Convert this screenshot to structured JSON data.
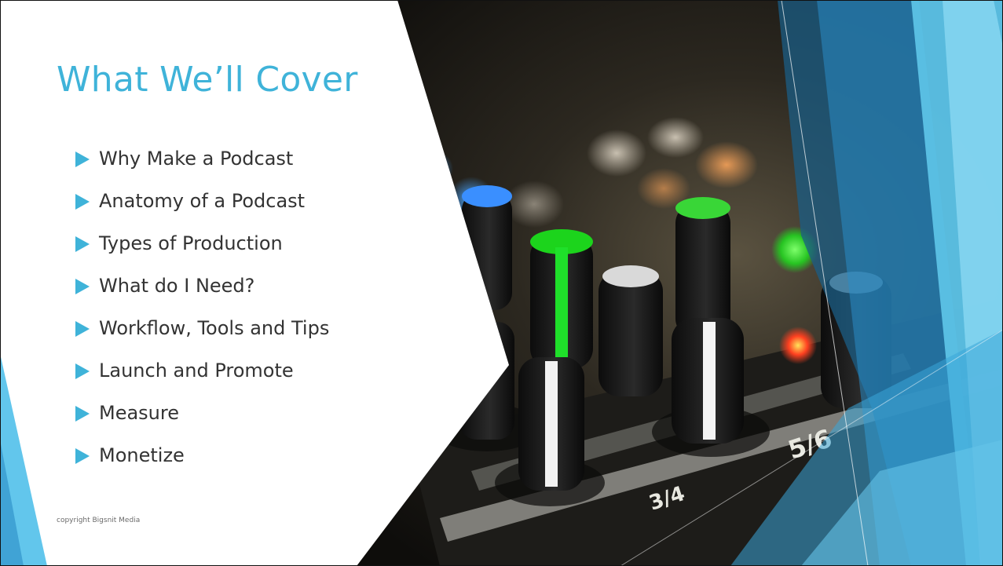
{
  "slide": {
    "title": "What We’ll Cover",
    "bullets": [
      "Why Make a Podcast",
      "Anatomy of a Podcast",
      "Types of Production",
      "What do I Need?",
      "Workflow, Tools and Tips",
      "Launch and Promote",
      "Measure",
      "Monetize"
    ],
    "footer": "copyright Bigsnit Media"
  },
  "photo": {
    "subject": "audio mixing console knobs",
    "channel_labels": [
      "3/4",
      "5/6"
    ]
  },
  "colors": {
    "accent": "#3fb3d9",
    "accent_light": "#7fd3ef",
    "accent_dark": "#1d6f9c",
    "text": "#333333"
  }
}
